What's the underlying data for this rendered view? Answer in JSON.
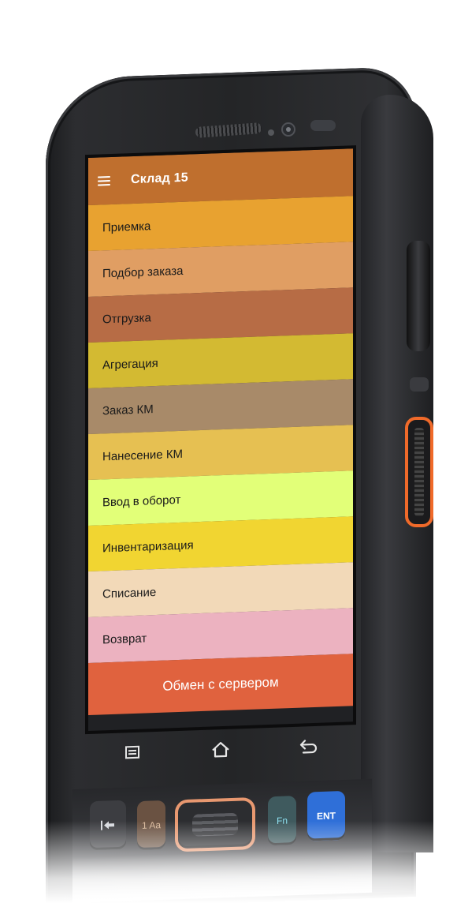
{
  "app": {
    "title": "Склад 15",
    "bar_color": "#bf6f2e"
  },
  "menu": {
    "items": [
      {
        "label": "Приемка",
        "color": "#e8a230"
      },
      {
        "label": "Подбор заказа",
        "color": "#e09e63"
      },
      {
        "label": "Отгрузка",
        "color": "#b76c45"
      },
      {
        "label": "Агрегация",
        "color": "#d3ba32"
      },
      {
        "label": "Заказ КМ",
        "color": "#a88a69"
      },
      {
        "label": "Нанесение КМ",
        "color": "#e6c052"
      },
      {
        "label": "Ввод в оборот",
        "color": "#e2ff78"
      },
      {
        "label": "Инвентаризация",
        "color": "#f1d531"
      },
      {
        "label": "Списание",
        "color": "#f2d9b8"
      },
      {
        "label": "Возврат",
        "color": "#ecb2c0"
      }
    ],
    "exchange_label": "Обмен с сервером"
  },
  "navbar": {
    "icons": [
      "recents-icon",
      "home-icon",
      "back-icon"
    ]
  },
  "keypad": {
    "k1": "1 Aa",
    "fn": "Fn",
    "ent": "ENT"
  },
  "colors": {
    "exchange": "#e0623e",
    "accent_key": "#f06a2a"
  }
}
